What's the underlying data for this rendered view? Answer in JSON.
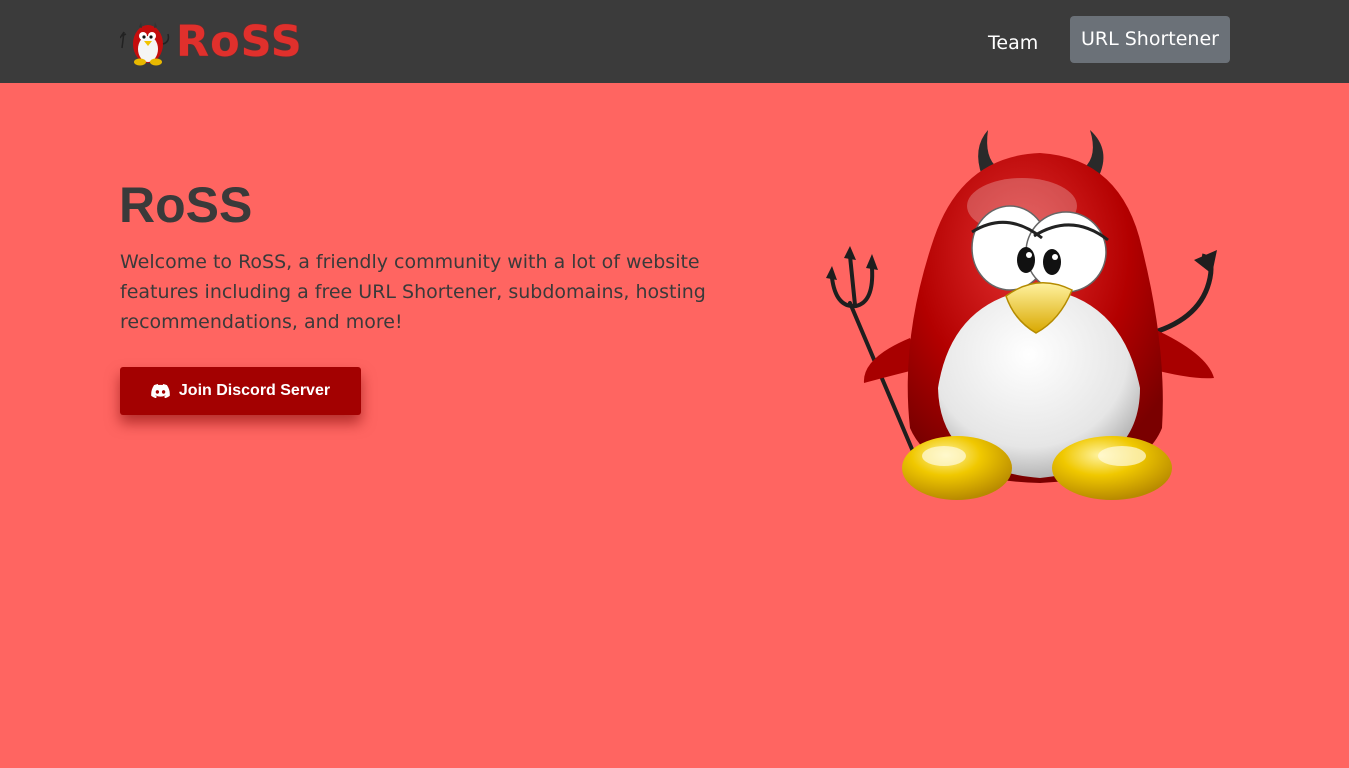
{
  "navbar": {
    "brand": "RoSS",
    "logo_icon": "devil-penguin-logo",
    "links": [
      {
        "label": "Team"
      },
      {
        "label": "URL Shortener"
      }
    ]
  },
  "hero": {
    "title": "RoSS",
    "description": "Welcome to RoSS, a friendly community with a lot of website features including a free URL Shortener, subdomains, hosting recommendations, and more!",
    "cta": {
      "label": "Join Discord Server",
      "icon": "discord-icon"
    },
    "illustration": "devil-penguin-mascot"
  },
  "colors": {
    "background": "#ff6561",
    "navbar": "#3b3b3b",
    "accent_button": "#a30101",
    "nav_button": "#6b7178",
    "text": "#3a3a3a"
  }
}
